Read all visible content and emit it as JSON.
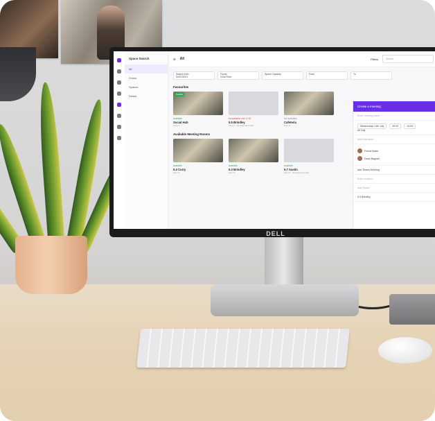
{
  "screen_app": {
    "nav_title": "Space Search",
    "nav_items": [
      "All",
      "Zones",
      "Spaces",
      "Desks"
    ],
    "header_title": "All",
    "filters_label": "Filters",
    "search_placeholder": "Search",
    "filter_fields": [
      {
        "label": "Search from",
        "value": "04/07/2021"
      },
      {
        "label": "Floors",
        "value": "22nd Floor"
      },
      {
        "label": "",
        "value": "Space Capacity"
      },
      {
        "label": "",
        "value": "From"
      },
      {
        "label": "",
        "value": "To"
      }
    ],
    "favourites_title": "Favourites",
    "favourites": [
      {
        "status": "Available",
        "status_kind": "ok",
        "name": "Social Hub",
        "sub": "Zone 6"
      },
      {
        "status": "Unavailable until 12:30",
        "status_kind": "warn",
        "name": "5.5 Brindley",
        "sub": "Floor 5 · Development Hub"
      },
      {
        "status": "Not bookable",
        "status_kind": "info",
        "name": "Cafeteria",
        "sub": "Zone 6"
      }
    ],
    "rooms_title": "Available Meeting Rooms",
    "rooms": [
      {
        "status": "Available",
        "name": "5.4 Curry",
        "sub": "Floor 5"
      },
      {
        "status": "Available",
        "name": "5.3 Brindley",
        "sub": "Floor 5"
      },
      {
        "status": "Available",
        "name": "5.7 Austin",
        "sub": "Floor 5 · Development Hub"
      }
    ],
    "panel": {
      "title": "Create a meeting",
      "name_placeholder": "Enter meeting name",
      "date": "Wednesday 14th July",
      "time_start": "09:00",
      "time_end": "10:00",
      "all_day": "All Day",
      "add_attendees": "Add Attendees",
      "attendees": [
        "Fenna Baker",
        "Dean Bagnall"
      ],
      "teams_label": "Add Teams Meeting",
      "location_placeholder": "Enter location",
      "space_placeholder": "Add Space",
      "selected_space": "5.3 Brindley"
    }
  },
  "monitor_brand": "DELL"
}
